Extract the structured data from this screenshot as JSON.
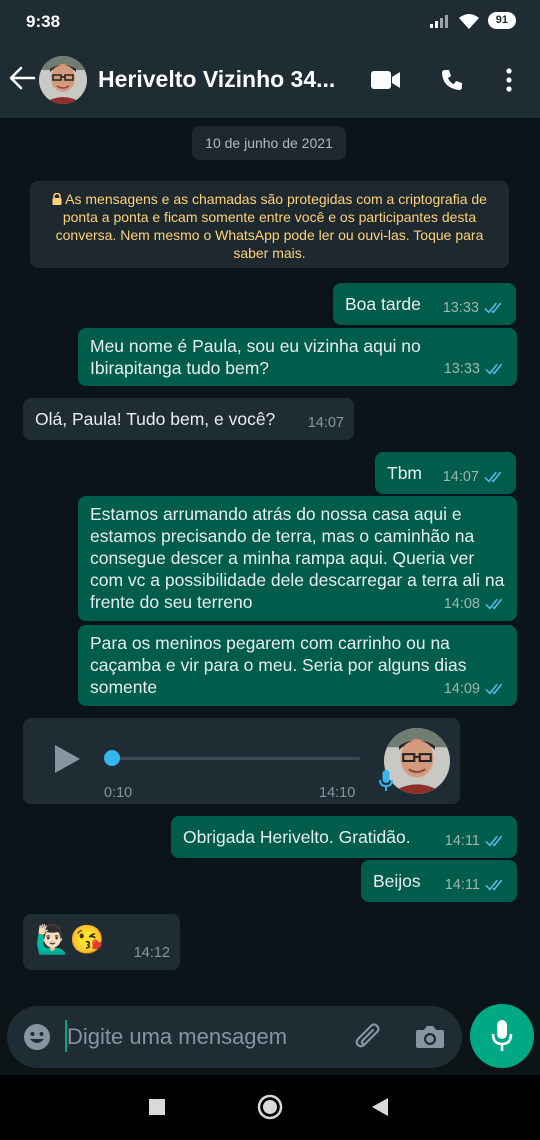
{
  "status_bar": {
    "time": "9:38",
    "battery_level": "91"
  },
  "header": {
    "contact_name": "Herivelto Vizinho 34..."
  },
  "chat": {
    "date_chip": "10 de junho de 2021",
    "encryption_notice": "As mensagens e as chamadas são protegidas com a criptografia de ponta a ponta e ficam somente entre você e os participantes desta conversa. Nem mesmo o WhatsApp pode ler ou ouvi-las. Toque para saber mais.",
    "messages": [
      {
        "direction": "out",
        "text": "Boa tarde",
        "time": "13:33",
        "status": "read"
      },
      {
        "direction": "out",
        "text": "Meu nome é Paula, sou eu vizinha aqui no Ibirapitanga tudo bem?",
        "time": "13:33",
        "status": "read"
      },
      {
        "direction": "in",
        "text": "Olá, Paula! Tudo bem, e você?",
        "time": "14:07"
      },
      {
        "direction": "out",
        "text": "Tbm",
        "time": "14:07",
        "status": "read"
      },
      {
        "direction": "out",
        "text": "Estamos arrumando atrás do nossa casa aqui e estamos precisando de terra, mas o caminhão na consegue descer a minha rampa aqui. Queria ver com vc a possibilidade dele descarregar a terra ali na frente do seu terreno",
        "time": "14:08",
        "status": "read"
      },
      {
        "direction": "out",
        "text": "Para os meninos pegarem com carrinho ou na caçamba e vir para o meu. Seria por alguns dias somente",
        "time": "14:09",
        "status": "read"
      },
      {
        "direction": "in",
        "type": "voice",
        "duration": "0:10",
        "time": "14:10",
        "progress": 0
      },
      {
        "direction": "out",
        "text": "Obrigada Herivelto. Gratidão.",
        "time": "14:11",
        "status": "read"
      },
      {
        "direction": "out",
        "text": "Beijos",
        "time": "14:11",
        "status": "read"
      },
      {
        "direction": "in",
        "text": "🙋🏻‍♂️😘",
        "time": "14:12"
      }
    ]
  },
  "composer": {
    "placeholder": "Digite uma mensagem"
  },
  "colors": {
    "outgoing_bubble": "#005c4b",
    "incoming_bubble": "#202c33",
    "accent": "#00a884",
    "read_ticks": "#53bdeb"
  },
  "icons": [
    "back-arrow-icon",
    "video-call-icon",
    "phone-icon",
    "more-options-icon",
    "lock-icon",
    "play-icon",
    "microphone-icon",
    "emoji-icon",
    "attach-icon",
    "camera-icon",
    "nav-square-icon",
    "nav-home-icon",
    "nav-back-icon"
  ]
}
